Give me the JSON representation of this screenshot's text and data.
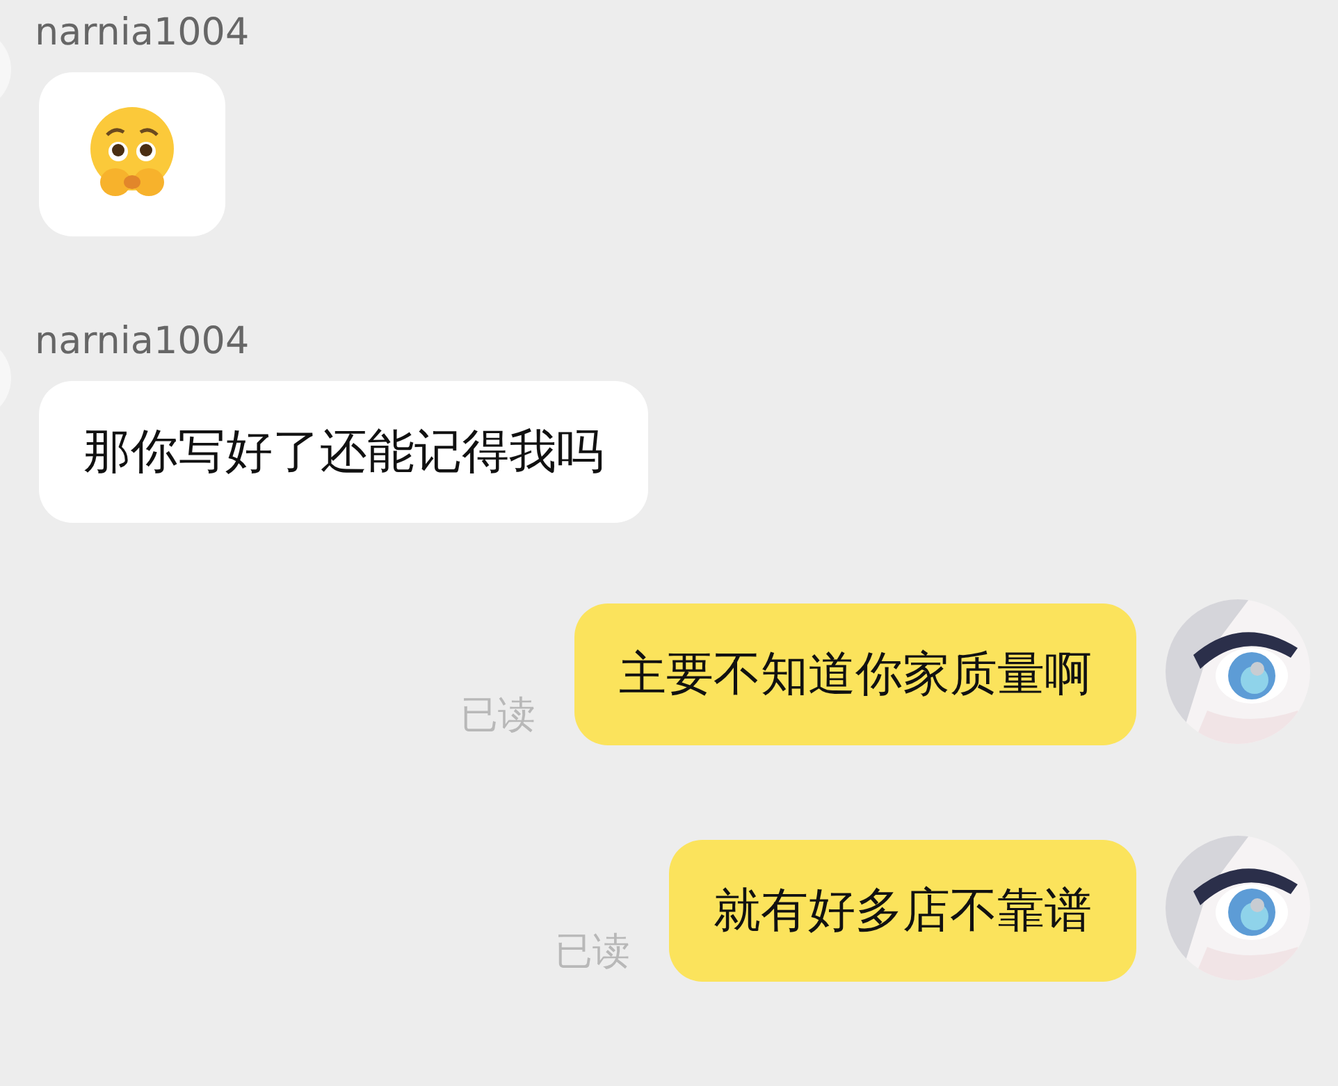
{
  "messages": [
    {
      "kind": "sticker",
      "sender": "narnia1004"
    },
    {
      "kind": "text",
      "sender": "narnia1004",
      "text": "那你写好了还能记得我吗"
    },
    {
      "kind": "sent_text",
      "text": "主要不知道你家质量啊",
      "read_label": "已读"
    },
    {
      "kind": "sent_text",
      "text": "就有好多店不靠谱",
      "read_label": "已读"
    }
  ]
}
